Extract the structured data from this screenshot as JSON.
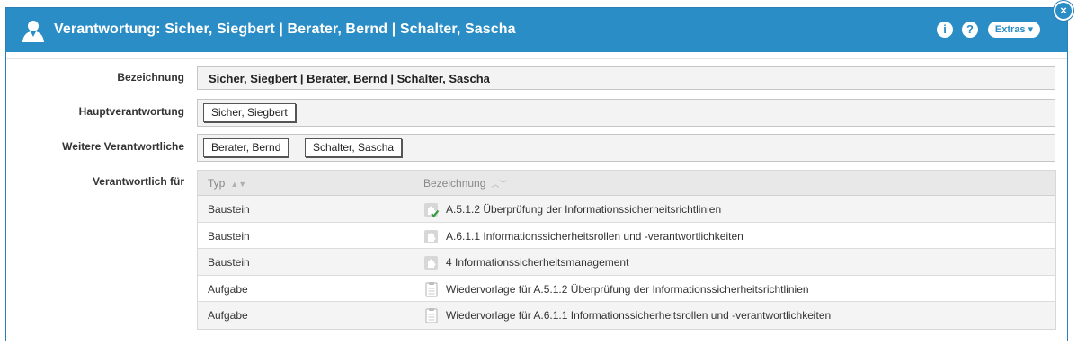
{
  "dialog": {
    "title": "Verantwortung: Sicher, Siegbert | Berater, Bernd | Schalter, Sascha",
    "info_label": "i",
    "help_label": "?",
    "extras_label": "Extras ▾",
    "close_label": "×"
  },
  "form": {
    "bezeichnung_label": "Bezeichnung",
    "bezeichnung_value": "Sicher, Siegbert | Berater, Bernd | Schalter, Sascha",
    "haupt_label": "Hauptverantwortung",
    "haupt_values": [
      "Sicher, Siegbert"
    ],
    "weitere_label": "Weitere Verantwortliche",
    "weitere_values": [
      "Berater, Bernd",
      "Schalter, Sascha"
    ],
    "verantwortlich_label": "Verantwortlich für"
  },
  "table": {
    "columns": [
      "Typ",
      "Bezeichnung"
    ],
    "rows": [
      {
        "typ": "Baustein",
        "icon": "puzzle-check-icon",
        "bezeichnung": "A.5.1.2 Überprüfung der Informationssicherheitsrichtlinien"
      },
      {
        "typ": "Baustein",
        "icon": "puzzle-icon",
        "bezeichnung": "A.6.1.1 Informationssicherheitsrollen und -verantwortlichkeiten"
      },
      {
        "typ": "Baustein",
        "icon": "puzzle-icon",
        "bezeichnung": "4 Informationssicherheitsmanagement"
      },
      {
        "typ": "Aufgabe",
        "icon": "clipboard-icon",
        "bezeichnung": "Wiedervorlage für A.5.1.2 Überprüfung der Informationssicherheitsrichtlinien"
      },
      {
        "typ": "Aufgabe",
        "icon": "clipboard-icon",
        "bezeichnung": "Wiedervorlage für A.6.1.1 Informationssicherheitsrollen und -verantwortlichkeiten"
      }
    ]
  },
  "colors": {
    "header": "#2a8dc5",
    "check": "#2e9a3a"
  }
}
